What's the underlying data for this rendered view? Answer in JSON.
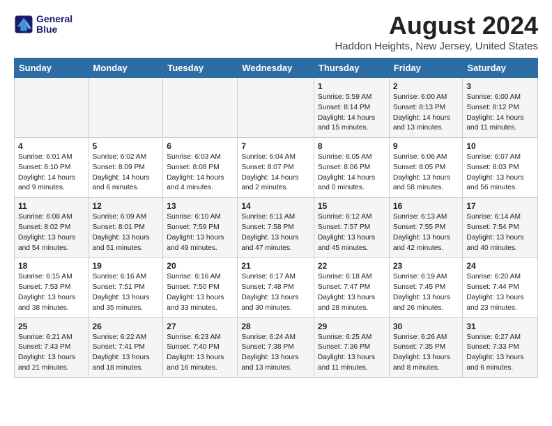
{
  "header": {
    "logo_line1": "General",
    "logo_line2": "Blue",
    "main_title": "August 2024",
    "subtitle": "Haddon Heights, New Jersey, United States"
  },
  "days_of_week": [
    "Sunday",
    "Monday",
    "Tuesday",
    "Wednesday",
    "Thursday",
    "Friday",
    "Saturday"
  ],
  "weeks": [
    [
      {
        "day": "",
        "content": ""
      },
      {
        "day": "",
        "content": ""
      },
      {
        "day": "",
        "content": ""
      },
      {
        "day": "",
        "content": ""
      },
      {
        "day": "1",
        "content": "Sunrise: 5:59 AM\nSunset: 8:14 PM\nDaylight: 14 hours\nand 15 minutes."
      },
      {
        "day": "2",
        "content": "Sunrise: 6:00 AM\nSunset: 8:13 PM\nDaylight: 14 hours\nand 13 minutes."
      },
      {
        "day": "3",
        "content": "Sunrise: 6:00 AM\nSunset: 8:12 PM\nDaylight: 14 hours\nand 11 minutes."
      }
    ],
    [
      {
        "day": "4",
        "content": "Sunrise: 6:01 AM\nSunset: 8:10 PM\nDaylight: 14 hours\nand 9 minutes."
      },
      {
        "day": "5",
        "content": "Sunrise: 6:02 AM\nSunset: 8:09 PM\nDaylight: 14 hours\nand 6 minutes."
      },
      {
        "day": "6",
        "content": "Sunrise: 6:03 AM\nSunset: 8:08 PM\nDaylight: 14 hours\nand 4 minutes."
      },
      {
        "day": "7",
        "content": "Sunrise: 6:04 AM\nSunset: 8:07 PM\nDaylight: 14 hours\nand 2 minutes."
      },
      {
        "day": "8",
        "content": "Sunrise: 6:05 AM\nSunset: 8:06 PM\nDaylight: 14 hours\nand 0 minutes."
      },
      {
        "day": "9",
        "content": "Sunrise: 6:06 AM\nSunset: 8:05 PM\nDaylight: 13 hours\nand 58 minutes."
      },
      {
        "day": "10",
        "content": "Sunrise: 6:07 AM\nSunset: 8:03 PM\nDaylight: 13 hours\nand 56 minutes."
      }
    ],
    [
      {
        "day": "11",
        "content": "Sunrise: 6:08 AM\nSunset: 8:02 PM\nDaylight: 13 hours\nand 54 minutes."
      },
      {
        "day": "12",
        "content": "Sunrise: 6:09 AM\nSunset: 8:01 PM\nDaylight: 13 hours\nand 51 minutes."
      },
      {
        "day": "13",
        "content": "Sunrise: 6:10 AM\nSunset: 7:59 PM\nDaylight: 13 hours\nand 49 minutes."
      },
      {
        "day": "14",
        "content": "Sunrise: 6:11 AM\nSunset: 7:58 PM\nDaylight: 13 hours\nand 47 minutes."
      },
      {
        "day": "15",
        "content": "Sunrise: 6:12 AM\nSunset: 7:57 PM\nDaylight: 13 hours\nand 45 minutes."
      },
      {
        "day": "16",
        "content": "Sunrise: 6:13 AM\nSunset: 7:55 PM\nDaylight: 13 hours\nand 42 minutes."
      },
      {
        "day": "17",
        "content": "Sunrise: 6:14 AM\nSunset: 7:54 PM\nDaylight: 13 hours\nand 40 minutes."
      }
    ],
    [
      {
        "day": "18",
        "content": "Sunrise: 6:15 AM\nSunset: 7:53 PM\nDaylight: 13 hours\nand 38 minutes."
      },
      {
        "day": "19",
        "content": "Sunrise: 6:16 AM\nSunset: 7:51 PM\nDaylight: 13 hours\nand 35 minutes."
      },
      {
        "day": "20",
        "content": "Sunrise: 6:16 AM\nSunset: 7:50 PM\nDaylight: 13 hours\nand 33 minutes."
      },
      {
        "day": "21",
        "content": "Sunrise: 6:17 AM\nSunset: 7:48 PM\nDaylight: 13 hours\nand 30 minutes."
      },
      {
        "day": "22",
        "content": "Sunrise: 6:18 AM\nSunset: 7:47 PM\nDaylight: 13 hours\nand 28 minutes."
      },
      {
        "day": "23",
        "content": "Sunrise: 6:19 AM\nSunset: 7:45 PM\nDaylight: 13 hours\nand 26 minutes."
      },
      {
        "day": "24",
        "content": "Sunrise: 6:20 AM\nSunset: 7:44 PM\nDaylight: 13 hours\nand 23 minutes."
      }
    ],
    [
      {
        "day": "25",
        "content": "Sunrise: 6:21 AM\nSunset: 7:43 PM\nDaylight: 13 hours\nand 21 minutes."
      },
      {
        "day": "26",
        "content": "Sunrise: 6:22 AM\nSunset: 7:41 PM\nDaylight: 13 hours\nand 18 minutes."
      },
      {
        "day": "27",
        "content": "Sunrise: 6:23 AM\nSunset: 7:40 PM\nDaylight: 13 hours\nand 16 minutes."
      },
      {
        "day": "28",
        "content": "Sunrise: 6:24 AM\nSunset: 7:38 PM\nDaylight: 13 hours\nand 13 minutes."
      },
      {
        "day": "29",
        "content": "Sunrise: 6:25 AM\nSunset: 7:36 PM\nDaylight: 13 hours\nand 11 minutes."
      },
      {
        "day": "30",
        "content": "Sunrise: 6:26 AM\nSunset: 7:35 PM\nDaylight: 13 hours\nand 8 minutes."
      },
      {
        "day": "31",
        "content": "Sunrise: 6:27 AM\nSunset: 7:33 PM\nDaylight: 13 hours\nand 6 minutes."
      }
    ]
  ]
}
